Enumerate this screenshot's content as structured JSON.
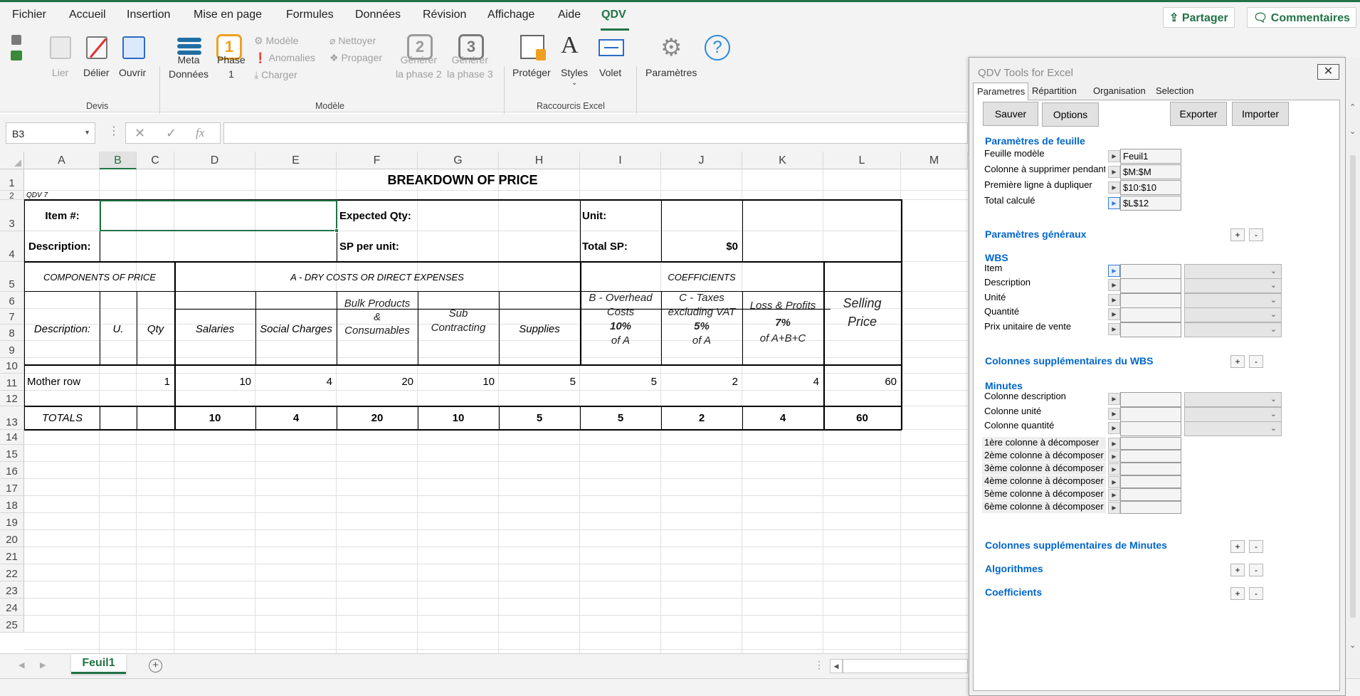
{
  "menu": {
    "tabs": [
      "Fichier",
      "Accueil",
      "Insertion",
      "Mise en page",
      "Formules",
      "Données",
      "Révision",
      "Affichage",
      "Aide",
      "QDV"
    ],
    "active": "QDV",
    "share_label": "Partager",
    "comments_label": "Commentaires"
  },
  "ribbon": {
    "devis": {
      "lier": "Lier",
      "delier": "Délier",
      "ouvrir": "Ouvrir",
      "group": "Devis"
    },
    "modele": {
      "meta1": "Meta",
      "meta2": "Données",
      "phase1_num": "1",
      "phase1_a": "Phase",
      "phase1_b": "1",
      "modele": "Modèle",
      "anomalies": "Anomalies",
      "charger": "Charger",
      "nettoyer": "Nettoyer",
      "propager": "Propager",
      "gen2_num": "2",
      "gen2_a": "Générer",
      "gen2_b": "la phase 2",
      "gen3_num": "3",
      "gen3_a": "Générer",
      "gen3_b": "la phase 3",
      "group": "Modèle"
    },
    "raccourcis": {
      "proteger": "Protéger",
      "styles": "Styles",
      "volet": "Volet",
      "group": "Raccourcis Excel"
    },
    "parametres": "Paramètres"
  },
  "formula_bar": {
    "namebox": "B3",
    "fx": "fx",
    "value": ""
  },
  "grid": {
    "columns": [
      "A",
      "B",
      "C",
      "D",
      "E",
      "F",
      "G",
      "H",
      "I",
      "J",
      "K",
      "L",
      "M"
    ],
    "selected_column": "B",
    "rows": [
      "1",
      "2",
      "3",
      "4",
      "5",
      "6",
      "7",
      "8",
      "9",
      "10",
      "11",
      "12",
      "13",
      "14",
      "15",
      "16",
      "17",
      "18",
      "19",
      "20",
      "21",
      "22",
      "23",
      "24",
      "25"
    ]
  },
  "sheet": {
    "title": "BREAKDOWN OF PRICE",
    "qdv_tag": "QDV 7",
    "item_label": "Item #:",
    "expected_qty_label": "Expected Qty:",
    "unit_label": "Unit:",
    "description_label": "Description:",
    "sp_per_unit_label": "SP per unit:",
    "total_sp_label": "Total SP:",
    "total_sp_value": "$0",
    "components_header": "COMPONENTS OF PRICE",
    "dry_costs_header": "A - DRY COSTS OR DIRECT EXPENSES",
    "coefficients_header": "COEFFICIENTS",
    "col_headers": {
      "description": "Description:",
      "unit": "U.",
      "qty": "Qty",
      "salaries": "Salaries",
      "social": "Social Charges",
      "bulk1": "Bulk Products",
      "bulk2": "&",
      "bulk3": "Consumables",
      "sub1": "Sub",
      "sub2": "Contracting",
      "supplies": "Supplies",
      "overhead1": "B - Overhead",
      "overhead2": "Costs",
      "overhead_pct": "10%",
      "overhead_of": "of A",
      "taxes1": "C - Taxes",
      "taxes2": "excluding VAT",
      "taxes_pct": "5%",
      "taxes_of": "of A",
      "loss1": "Loss & Profits",
      "loss_pct": "7%",
      "loss_of": "of A+B+C",
      "selling1": "Selling",
      "selling2": "Price"
    },
    "mother_row": {
      "label": "Mother row",
      "qty": "1",
      "salaries": "10",
      "social": "4",
      "bulk": "20",
      "sub": "10",
      "supplies": "5",
      "overhead": "5",
      "taxes": "2",
      "loss": "4",
      "selling": "60"
    },
    "totals_row": {
      "label": "TOTALS",
      "salaries": "10",
      "social": "4",
      "bulk": "20",
      "sub": "10",
      "supplies": "5",
      "overhead": "5",
      "taxes": "2",
      "loss": "4",
      "selling": "60"
    }
  },
  "sheet_tabs": {
    "active": "Feuil1",
    "add": "+"
  },
  "pane": {
    "title": "QDV Tools for Excel",
    "tabs": [
      "Parametres",
      "Répartition",
      "Organisation",
      "Selection"
    ],
    "buttons": {
      "save": "Sauver",
      "options": "Options",
      "export": "Exporter",
      "import": "Importer"
    },
    "sheet_params": {
      "title": "Paramètres de feuille",
      "rows": [
        {
          "label": "Feuille modèle",
          "value": "Feuil1"
        },
        {
          "label": "Colonne à supprimer pendant la co",
          "value": "$M:$M"
        },
        {
          "label": "Première ligne à dupliquer",
          "value": "$10:$10"
        },
        {
          "label": "Total calculé",
          "value": "$L$12"
        }
      ]
    },
    "general_params": "Paramètres généraux",
    "wbs": {
      "title": "WBS",
      "rows": [
        "Item",
        "Description",
        "Unité",
        "Quantité",
        "Prix unitaire de vente"
      ]
    },
    "wbs_extra": "Colonnes supplémentaires du WBS",
    "minutes": {
      "title": "Minutes",
      "rows": [
        "Colonne description",
        "Colonne unité",
        "Colonne quantité"
      ],
      "decomp": [
        "1ère colonne à décomposer",
        "2ème colonne à décomposer",
        "3ème colonne à décomposer",
        "4ème colonne à décomposer",
        "5ème colonne à décomposer",
        "6ème colonne à décomposer"
      ]
    },
    "minutes_extra": "Colonnes supplémentaires de Minutes",
    "algorithms": "Algorithmes",
    "coefficients": "Coefficients",
    "plus": "+",
    "minus": "-"
  }
}
